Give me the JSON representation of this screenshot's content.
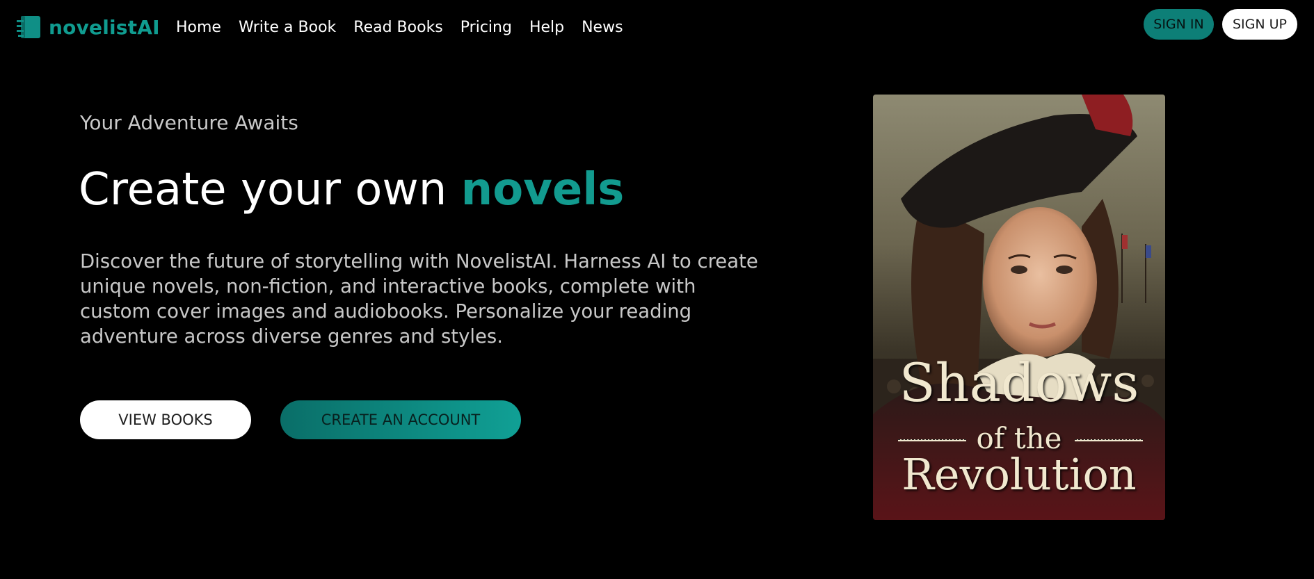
{
  "brand": {
    "name": "novelistAI",
    "logo_icon": "book-stack-icon",
    "accent_color": "#129b8f"
  },
  "nav": {
    "items": [
      {
        "label": "Home"
      },
      {
        "label": "Write a Book"
      },
      {
        "label": "Read Books"
      },
      {
        "label": "Pricing"
      },
      {
        "label": "Help"
      },
      {
        "label": "News"
      }
    ]
  },
  "auth": {
    "sign_in": "SIGN IN",
    "sign_up": "SIGN UP"
  },
  "hero": {
    "eyebrow": "Your Adventure Awaits",
    "headline_prefix": "Create your own",
    "headline_accent": "novels",
    "description": "Discover the future of storytelling with NovelistAI. Harness AI to create unique novels, non-fiction, and interactive books, complete with custom cover images and audiobooks. Personalize your reading adventure across diverse genres and styles.",
    "view_books": "VIEW BOOKS",
    "create_account": "CREATE AN ACCOUNT"
  },
  "featured_book": {
    "title_line1": "Shadows",
    "title_line2": "of the",
    "title_line3": "Revolution"
  }
}
